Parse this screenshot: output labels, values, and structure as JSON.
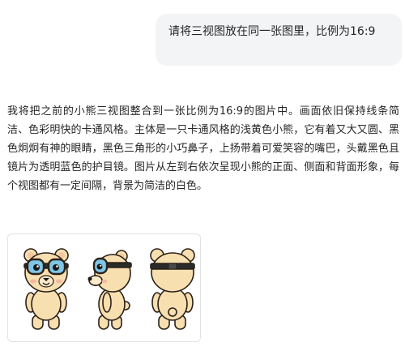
{
  "conversation": {
    "user_message": "请将三视图放在同一张图里，比例为16:9",
    "assistant_message": "我将把之前的小熊三视图整合到一张比例为16:9的图片中。画面依旧保持线条简洁、色彩明快的卡通风格。主体是一只卡通风格的浅黄色小熊，它有着又大又圆、黑色炯炯有神的眼睛，黑色三角形的小巧鼻子，上扬带着可爱笑容的嘴巴，头戴黑色且镜片为透明蓝色的护目镜。图片从左到右依次呈现小熊的正面、侧面和背面形象，每个视图都有一定间隔，背景为简洁的白色。"
  },
  "image": {
    "views": [
      "front",
      "side",
      "back"
    ],
    "colors": {
      "fur": "#f8dfb0",
      "outline": "#2b2118",
      "goggle_lens": "#7fc6e6",
      "goggle_strap": "#2b2b2b",
      "inner_ear": "#f3c7a0",
      "cheek": "#f4b7a2",
      "background": "#ffffff"
    }
  }
}
